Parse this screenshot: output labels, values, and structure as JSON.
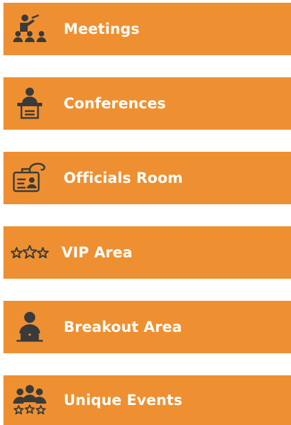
{
  "menu": {
    "items": [
      {
        "label": "Meetings",
        "icon": "meeting-presenter-icon"
      },
      {
        "label": "Conferences",
        "icon": "podium-speaker-icon"
      },
      {
        "label": "Officials Room",
        "icon": "id-badge-icon"
      },
      {
        "label": "VIP Area",
        "icon": "three-stars-icon"
      },
      {
        "label": "Breakout Area",
        "icon": "person-laptop-icon"
      },
      {
        "label": "Unique Events",
        "icon": "group-stars-icon"
      }
    ]
  },
  "colors": {
    "tile_background": "#ee9031",
    "icon_color": "#3a3a3a",
    "label_color": "#ffffff"
  }
}
